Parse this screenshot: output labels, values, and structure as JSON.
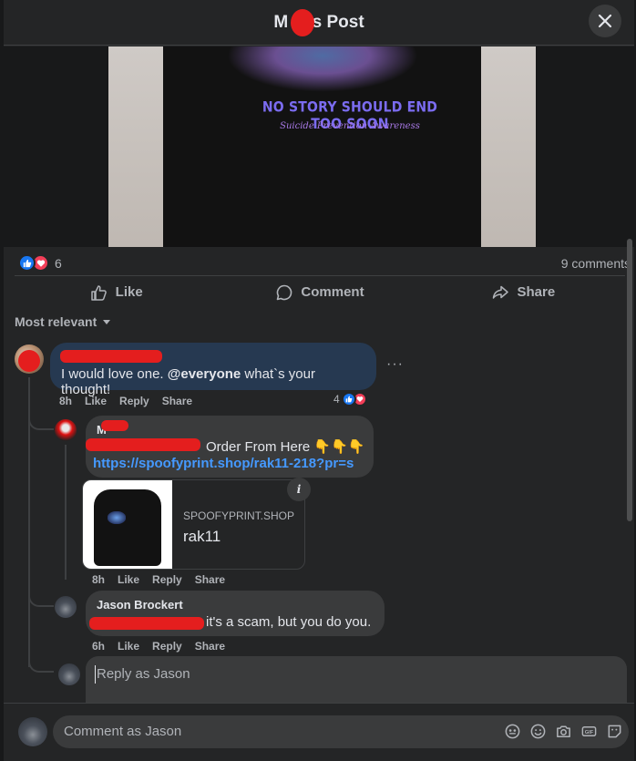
{
  "header": {
    "title_prefix": "M",
    "title_suffix": "'s Post"
  },
  "post_image": {
    "shirt_line1": "NO STORY SHOULD END TOO SOON",
    "shirt_line2": "Suicide Prevention Awareness"
  },
  "reactions": {
    "count": "6",
    "comments": "9 comments"
  },
  "actions": {
    "like": "Like",
    "comment": "Comment",
    "share": "Share"
  },
  "sort": {
    "label": "Most relevant"
  },
  "comment1": {
    "text_before": "I would love one. ",
    "mention": "@everyone",
    "text_after": " what`s your thought!",
    "time": "8h",
    "like": "Like",
    "reply": "Reply",
    "share": "Share",
    "reaction_count": "4"
  },
  "reply1": {
    "name_initial": "M",
    "text": "Order From Here 👇👇👇",
    "link": "https://spoofyprint.shop/rak11-218?pr=s",
    "card_domain": "SPOOFYPRINT.SHOP",
    "card_title": "rak11",
    "time": "8h",
    "like": "Like",
    "reply": "Reply",
    "share": "Share"
  },
  "reply2": {
    "name": "Jason Brockert",
    "text": "it's a scam, but you do you.",
    "time": "6h",
    "like": "Like",
    "reply": "Reply",
    "share": "Share"
  },
  "reply_box": {
    "placeholder": "Reply as Jason"
  },
  "footer": {
    "placeholder": "Comment as Jason"
  },
  "colors": {
    "accent": "#1877f2",
    "love": "#f33e58",
    "link": "#4599ff",
    "redaction": "#e41e1e"
  }
}
